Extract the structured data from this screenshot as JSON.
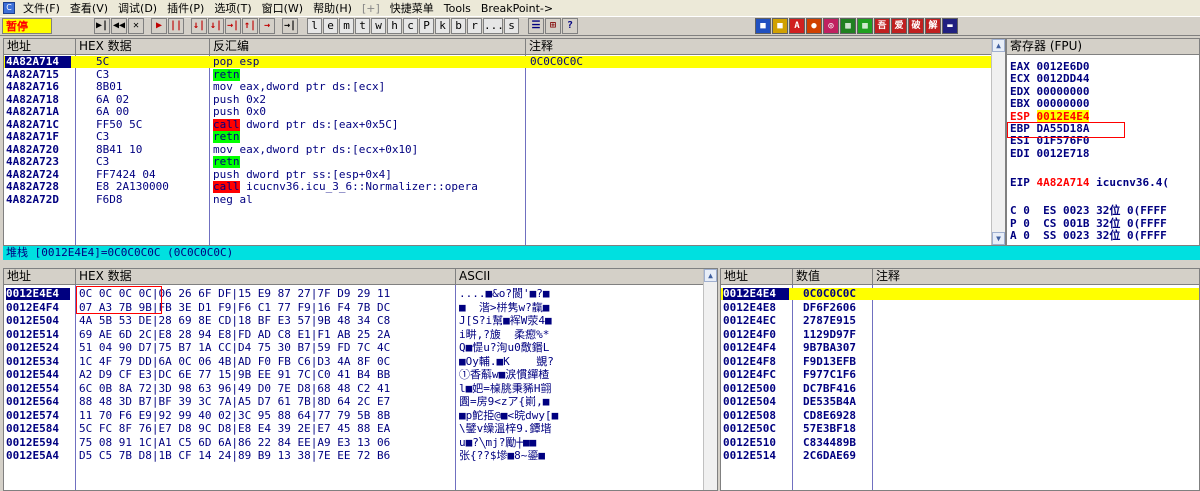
{
  "menubar": {
    "items": [
      "文件(F)",
      "查看(V)",
      "调试(D)",
      "插件(P)",
      "选项(T)",
      "窗口(W)",
      "帮助(H)",
      "[+]",
      "快捷菜单",
      "Tools",
      "BreakPoint->"
    ]
  },
  "toolbar": {
    "status": "暂停",
    "nav_buttons": [
      "▶|",
      "◀◀",
      "✕",
      "▶",
      "||",
      "↓|",
      "↓|",
      "→|",
      "↑|",
      "→",
      "→|"
    ],
    "letter_buttons": [
      "l",
      "e",
      "m",
      "t",
      "w",
      "h",
      "c",
      "P",
      "k",
      "b",
      "r",
      "...",
      "s"
    ],
    "misc_buttons": [
      "☰",
      "⊞",
      "?"
    ],
    "plugin_buttons": [
      {
        "label": "■",
        "color": "#2050c0"
      },
      {
        "label": "■",
        "color": "#d0a000"
      },
      {
        "label": "A",
        "color": "#d02020"
      },
      {
        "label": "●",
        "color": "#d04000"
      },
      {
        "label": "◎",
        "color": "#c02060"
      },
      {
        "label": "▦",
        "color": "#208020"
      },
      {
        "label": "▦",
        "color": "#20a020"
      },
      {
        "label": "吾",
        "color": "#c02020"
      },
      {
        "label": "爱",
        "color": "#c02020"
      },
      {
        "label": "破",
        "color": "#c02020"
      },
      {
        "label": "解",
        "color": "#c02020"
      },
      {
        "label": "▬",
        "color": "#202080"
      }
    ]
  },
  "disasm": {
    "headers": {
      "address": "地址",
      "hex": "HEX 数据",
      "disasm": "反汇编",
      "comment": "注释"
    },
    "rows": [
      {
        "addr": "4A82A714",
        "hex": "5C",
        "op": "pop",
        "args": " esp",
        "comment": "0C0C0C0C",
        "selected": true
      },
      {
        "addr": "4A82A715",
        "hex": "C3",
        "op": "retn",
        "args": "",
        "comment": "",
        "style": "green"
      },
      {
        "addr": "4A82A716",
        "hex": "8B01",
        "op": "mov",
        "args": " eax,dword ptr ds:[ecx]",
        "comment": ""
      },
      {
        "addr": "4A82A718",
        "hex": "6A 02",
        "op": "push",
        "args": " 0x2",
        "comment": ""
      },
      {
        "addr": "4A82A71A",
        "hex": "6A 00",
        "op": "push",
        "args": " 0x0",
        "comment": ""
      },
      {
        "addr": "4A82A71C",
        "hex": "FF50 5C",
        "op": "call",
        "args": " dword ptr ds:[eax+0x5C]",
        "comment": "",
        "style": "red"
      },
      {
        "addr": "4A82A71F",
        "hex": "C3",
        "op": "retn",
        "args": "",
        "comment": "",
        "style": "green"
      },
      {
        "addr": "4A82A720",
        "hex": "8B41 10",
        "op": "mov",
        "args": " eax,dword ptr ds:[ecx+0x10]",
        "comment": ""
      },
      {
        "addr": "4A82A723",
        "hex": "C3",
        "op": "retn",
        "args": "",
        "comment": "",
        "style": "green"
      },
      {
        "addr": "4A82A724",
        "hex": "FF7424 04",
        "op": "push",
        "args": " dword ptr ss:[esp+0x4]",
        "comment": ""
      },
      {
        "addr": "4A82A728",
        "hex": "E8 2A130000",
        "op": "call",
        "args": " icucnv36.icu_3_6::Normalizer::opera",
        "comment": "",
        "style": "red"
      },
      {
        "addr": "4A82A72D",
        "hex": "F6D8",
        "op": "neg",
        "args": " al",
        "comment": ""
      }
    ]
  },
  "registers": {
    "header": "寄存器 (FPU)",
    "rows": [
      {
        "text": "EAX 0012E6D0"
      },
      {
        "text": "ECX 0012DD44"
      },
      {
        "text": "EDX 00000000"
      },
      {
        "text": "EBX 00000000"
      },
      {
        "name": "ESP",
        "value": "0012E4E4",
        "highlight": true
      },
      {
        "text": "EBP DA55D18A"
      },
      {
        "text": "ESI 01F576F0"
      },
      {
        "text": "EDI 0012E718"
      },
      {
        "text": ""
      },
      {
        "eip_label": "EIP",
        "eip_value": "4A82A714",
        "eip_sym": " icucnv36.4("
      },
      {
        "text": ""
      },
      {
        "text": "C 0  ES 0023 32位 0(FFFF"
      },
      {
        "text": "P 0  CS 001B 32位 0(FFFF"
      },
      {
        "text": "A 0  SS 0023 32位 0(FFFF"
      }
    ]
  },
  "stackbar": {
    "text": "堆栈 [0012E4E4]=0C0C0C0C (0C0C0C0C)"
  },
  "dump": {
    "headers": {
      "address": "地址",
      "hex": "HEX 数据",
      "ascii": "ASCII"
    },
    "rows": [
      {
        "addr": "0012E4E4",
        "hex": "0C 0C 0C 0C|06 26 6F DF|15 E9 87 27|7F D9 29 11",
        "ascii": "....■&o?閬'■?■"
      },
      {
        "addr": "0012E4F4",
        "hex": "07 A3 7B 9B|FB 3E D1 F9|F6 C1 77 F9|16 F4 7B DC",
        "ascii": "■  湝>栟隽w?靝■"
      },
      {
        "addr": "0012E504",
        "hex": "4A 5B 53 DE|28 69 8E CD|18 BF E3 57|9B 48 34 C8",
        "ascii": "J[S?i幫■裈W荥4■"
      },
      {
        "addr": "0012E514",
        "hex": "69 AE 6D 2C|E8 28 94 E8|FD AD C8 E1|F1 AB 25 2A",
        "ascii": "i畊,?旇  柔瘛%*"
      },
      {
        "addr": "0012E524",
        "hex": "51 04 90 D7|75 B7 1A CC|D4 75 30 B7|59 FD 7C 4C",
        "ascii": "Q■惿u?洵u0敿鍲L"
      },
      {
        "addr": "0012E534",
        "hex": "1C 4F 79 DD|6A 0C 06 4B|AD F0 FB C6|D3 4A 8F 0C",
        "ascii": "■Oy輔.■K    覬?"
      },
      {
        "addr": "0012E544",
        "hex": "A2 D9 CF E3|DC 6E 77 15|9B EE 91 7C|C0 41 B4 BB",
        "ascii": "①香蔛w■涙慣繟楂"
      },
      {
        "addr": "0012E554",
        "hex": "6C 0B 8A 72|3D 98 63 96|49 D0 7E D8|68 48 C2 41",
        "ascii": "l■妑=槕朓秉豨H翧"
      },
      {
        "addr": "0012E564",
        "hex": "88 48 3D B7|BF 39 3C 7A|A5 D7 61 7B|8D 64 2C E7",
        "ascii": "圚=房9<zア{崱,■"
      },
      {
        "addr": "0012E574",
        "hex": "11 70 F6 E9|92 99 40 02|3C 95 88 64|77 79 5B 8B",
        "ascii": "■p鮀挋@■<晥dwy[■"
      },
      {
        "addr": "0012E584",
        "hex": "5C FC 8F 76|E7 D8 9C D8|E8 E4 39 2E|E7 45 88 EA",
        "ascii": "\\鐾v缲溫梓9.鐔堦"
      },
      {
        "addr": "0012E594",
        "hex": "75 08 91 1C|A1 C5 6D 6A|86 22 84 EE|A9 E3 13 06",
        "ascii": "u■?╲mj?勵┼■■"
      },
      {
        "addr": "0012E5A4",
        "hex": "D5 C5 7B D8|1B CF 14 24|89 B9 13 38|7E EE 72 B6",
        "ascii": "张{??$墋■8~鎏■"
      }
    ]
  },
  "stack": {
    "headers": {
      "address": "地址",
      "value": "数值",
      "comment": "注释"
    },
    "rows": [
      {
        "addr": "0012E4E4",
        "value": "0C0C0C0C",
        "selected": true
      },
      {
        "addr": "0012E4E8",
        "value": "DF6F2606"
      },
      {
        "addr": "0012E4EC",
        "value": "2787E915"
      },
      {
        "addr": "0012E4F0",
        "value": "1129D97F"
      },
      {
        "addr": "0012E4F4",
        "value": "9B7BA307"
      },
      {
        "addr": "0012E4F8",
        "value": "F9D13EFB"
      },
      {
        "addr": "0012E4FC",
        "value": "F977C1F6"
      },
      {
        "addr": "0012E500",
        "value": "DC7BF416"
      },
      {
        "addr": "0012E504",
        "value": "DE535B4A"
      },
      {
        "addr": "0012E508",
        "value": "CD8E6928"
      },
      {
        "addr": "0012E50C",
        "value": "57E3BF18"
      },
      {
        "addr": "0012E510",
        "value": "C834489B"
      },
      {
        "addr": "0012E514",
        "value": "2C6DAE69"
      }
    ]
  }
}
